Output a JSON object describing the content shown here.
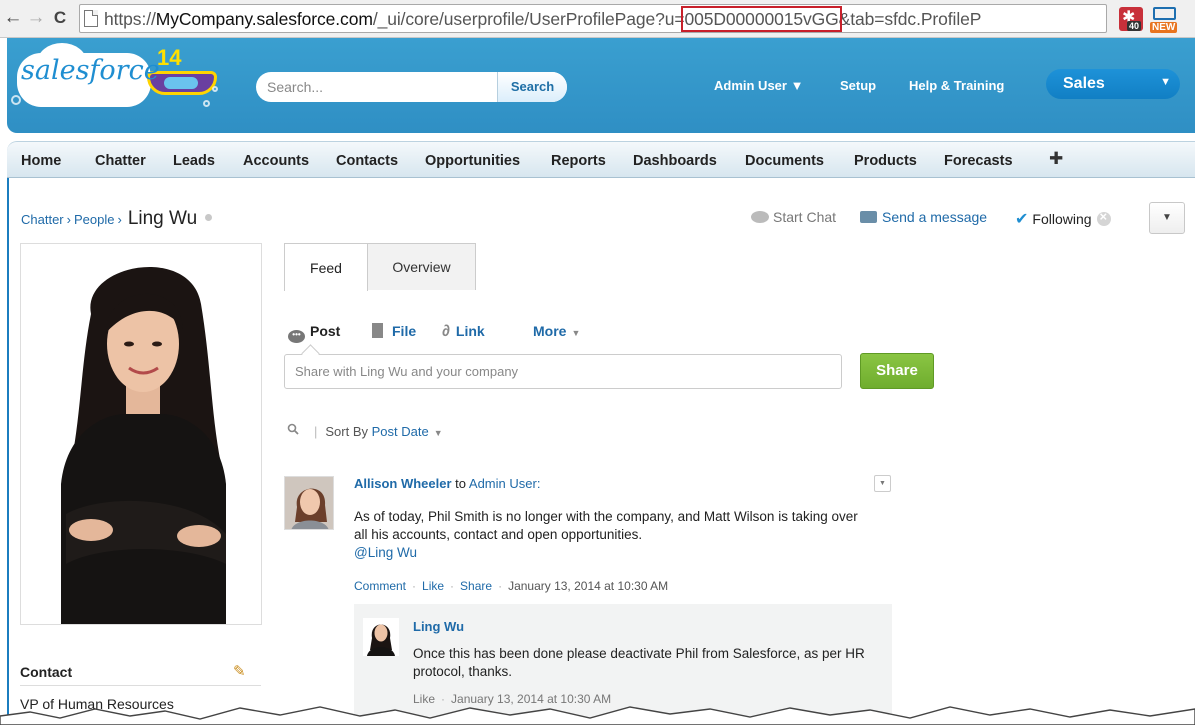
{
  "browser": {
    "url_prefix": "https://",
    "url_host": "MyCompany.salesforce.com",
    "url_path": "/_ui/core/userprofile/UserProfilePage?u=",
    "url_highlight": "005D00000015vGG",
    "url_suffix": "&tab=sfdc.ProfileP",
    "ext1_badge": "40",
    "ext2_badge": "NEW",
    "back_glyph": "←",
    "forward_glyph": "→",
    "reload_glyph": "C"
  },
  "header": {
    "logo_text": "salesforce",
    "logo_version": "14",
    "search_placeholder": "Search...",
    "search_button": "Search",
    "user_menu": "Admin User ▼",
    "setup": "Setup",
    "help": "Help & Training",
    "app": "Sales",
    "app_caret": "▼"
  },
  "tabs": [
    "Home",
    "Chatter",
    "Leads",
    "Accounts",
    "Contacts",
    "Opportunities",
    "Reports",
    "Dashboards",
    "Documents",
    "Products",
    "Forecasts"
  ],
  "tab_plus": "✚",
  "breadcrumb": {
    "chatter": "Chatter",
    "people": "People",
    "sep": "›",
    "name": "Ling Wu"
  },
  "profile_actions": {
    "start_chat": "Start Chat",
    "send_message": "Send a message",
    "following": "Following",
    "check": "✔",
    "menu_caret": "▼"
  },
  "contact": {
    "heading": "Contact",
    "edit_glyph": "✎",
    "title": "VP of Human Resources"
  },
  "feed_tabs": {
    "feed": "Feed",
    "overview": "Overview"
  },
  "publisher": {
    "post": "Post",
    "file": "File",
    "link": "Link",
    "more": "More",
    "more_caret": "▼",
    "link_glyph": "∂",
    "placeholder": "Share with Ling Wu and your company",
    "share": "Share"
  },
  "sort": {
    "search_glyph": "🔍",
    "label": "Sort By",
    "value": "Post Date",
    "caret": "▼"
  },
  "feed_item": {
    "author": "Allison Wheeler",
    "to_word": "to",
    "target": "Admin User:",
    "body": "As of today, Phil Smith is no longer with the company, and Matt Wilson is taking over all his accounts, contact and open opportunities.",
    "mention": "@Ling Wu",
    "actions": {
      "comment": "Comment",
      "like": "Like",
      "share": "Share",
      "dot": "·",
      "timestamp": "January 13, 2014 at 10:30 AM"
    },
    "menu_caret": "▼"
  },
  "comment": {
    "author": "Ling Wu",
    "body": "Once this has been done please deactivate Phil from Salesforce, as per HR protocol, thanks.",
    "like": "Like",
    "dot": "·",
    "timestamp": "January 13, 2014 at 10:30 AM"
  },
  "colors": {
    "header_blue": "#2f8fc4",
    "link_blue": "#1f6aa8",
    "share_green": "#7bb93a",
    "url_highlight_red": "#c8202a"
  }
}
